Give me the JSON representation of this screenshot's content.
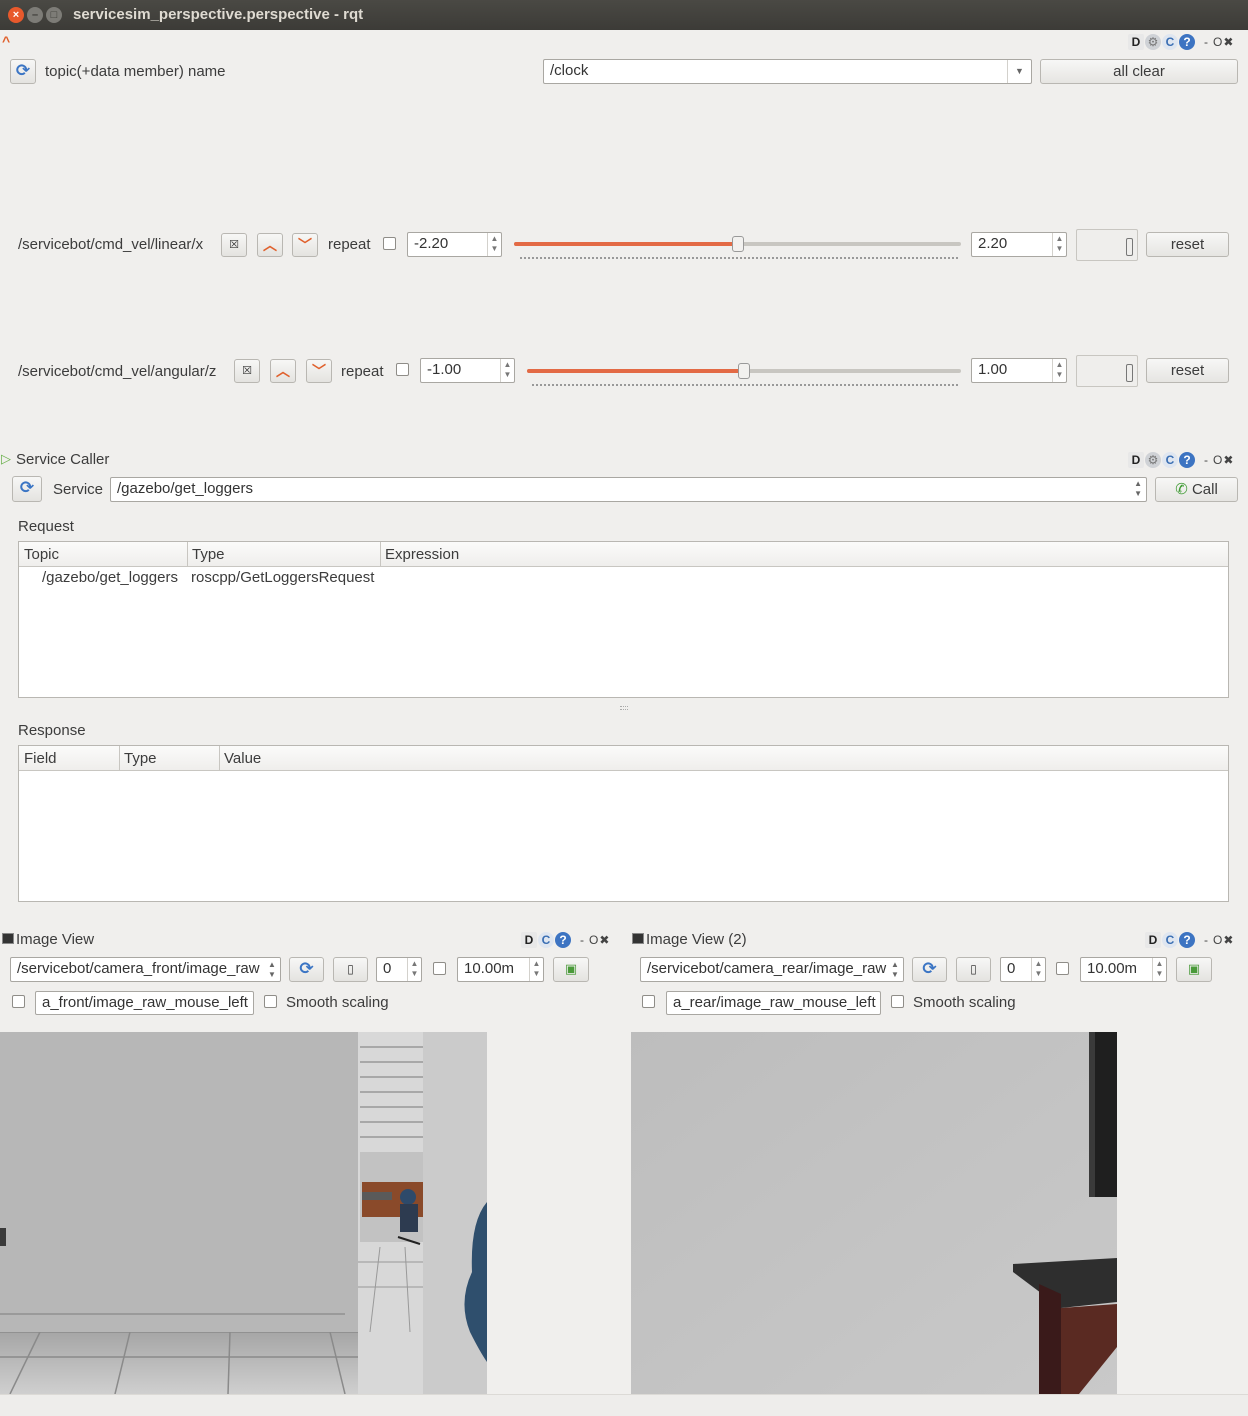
{
  "window": {
    "title": "servicesim_perspective.perspective - rqt",
    "close": "×",
    "minimize": "–",
    "maximize": "□"
  },
  "dock_tools": {
    "d": "D",
    "gear": "⚙",
    "refresh": "C",
    "help": "?",
    "min": "-",
    "float": "O",
    "close": "✖"
  },
  "publisher": {
    "collapse_icon": "^",
    "topic_label": "topic(+data member) name",
    "topic_value": "/clock",
    "all_clear": "all clear",
    "rows": [
      {
        "name": "/servicebot/cmd_vel/linear/x",
        "repeat": "repeat",
        "min": "-2.20",
        "max": "2.20",
        "value_fraction": 0.5,
        "reset": "reset"
      },
      {
        "name": "/servicebot/cmd_vel/angular/z",
        "repeat": "repeat",
        "min": "-1.00",
        "max": "1.00",
        "value_fraction": 0.5,
        "reset": "reset"
      }
    ]
  },
  "service_caller": {
    "title": "Service Caller",
    "service_label": "Service",
    "service_value": "/gazebo/get_loggers",
    "call": "Call",
    "request_label": "Request",
    "request_headers": [
      "Topic",
      "Type",
      "Expression"
    ],
    "request_rows": [
      {
        "topic": "/gazebo/get_loggers",
        "type": "roscpp/GetLoggersRequest",
        "expression": ""
      }
    ],
    "response_label": "Response",
    "response_headers": [
      "Field",
      "Type",
      "Value"
    ]
  },
  "image_views": [
    {
      "title": "Image View",
      "topic": "/servicebot/camera_front/image_raw",
      "num": "0",
      "duration": "10.00m",
      "mouse_topic": "a_front/image_raw_mouse_left",
      "smooth": "Smooth scaling"
    },
    {
      "title": "Image View (2)",
      "topic": "/servicebot/camera_rear/image_raw",
      "num": "0",
      "duration": "10.00m",
      "mouse_topic": "a_rear/image_raw_mouse_left",
      "smooth": "Smooth scaling"
    }
  ]
}
